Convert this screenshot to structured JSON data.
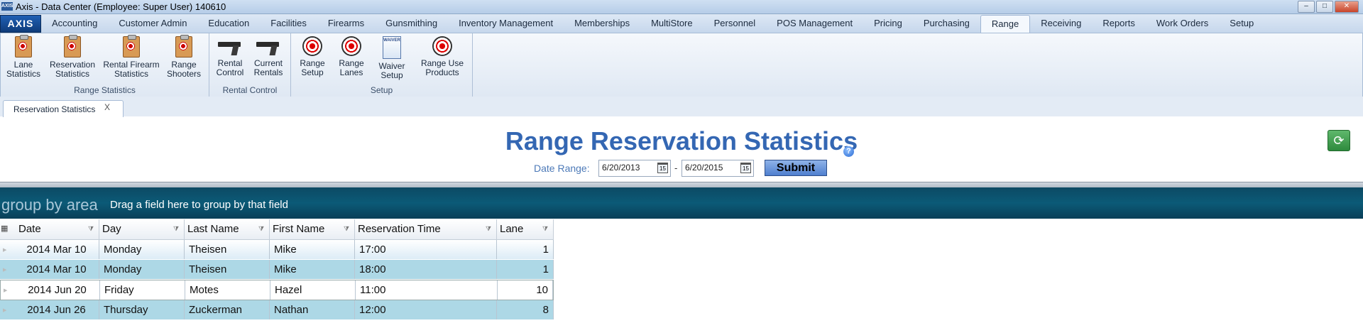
{
  "window": {
    "title": "Axis - Data Center  (Employee: Super User) 140610",
    "app_icon": "AXIS",
    "buttons": {
      "minimize": "–",
      "maximize": "□",
      "close": "✕"
    }
  },
  "menu": {
    "logo": "AXIS",
    "tabs": [
      "Accounting",
      "Customer Admin",
      "Education",
      "Facilities",
      "Firearms",
      "Gunsmithing",
      "Inventory Management",
      "Memberships",
      "MultiStore",
      "Personnel",
      "POS Management",
      "Pricing",
      "Purchasing",
      "Range",
      "Receiving",
      "Reports",
      "Work Orders",
      "Setup"
    ],
    "active_tab": "Range"
  },
  "ribbon": {
    "groups": [
      {
        "label": "Range Statistics",
        "buttons": [
          {
            "line1": "Lane",
            "line2": "Statistics",
            "icon": "clipboard-target-icon"
          },
          {
            "line1": "Reservation",
            "line2": "Statistics",
            "icon": "clipboard-target-icon"
          },
          {
            "line1": "Rental Firearm",
            "line2": "Statistics",
            "icon": "clipboard-gun-icon"
          },
          {
            "line1": "Range",
            "line2": "Shooters",
            "icon": "clipboard-shooter-icon"
          }
        ]
      },
      {
        "label": "Rental Control",
        "buttons": [
          {
            "line1": "Rental",
            "line2": "Control",
            "icon": "pistol-icon"
          },
          {
            "line1": "Current",
            "line2": "Rentals",
            "icon": "pistol-icon"
          }
        ]
      },
      {
        "label": "Setup",
        "buttons": [
          {
            "line1": "Range",
            "line2": "Setup",
            "icon": "target-icon"
          },
          {
            "line1": "Range",
            "line2": "Lanes",
            "icon": "target-icon"
          },
          {
            "line1": "Waiver",
            "line2": "Setup",
            "icon": "waiver-document-icon",
            "badge": "WAIVER"
          },
          {
            "line1": "Range Use",
            "line2": "Products",
            "icon": "target-icon"
          }
        ]
      }
    ]
  },
  "doc_tab": {
    "label": "Reservation Statistics",
    "close": "X"
  },
  "page": {
    "title": "Range Reservation Statistics",
    "help": "?",
    "refresh_icon": "refresh-icon",
    "date_range_label": "Date Range:",
    "start_date": "6/20/2013",
    "end_date": "6/20/2015",
    "date_separator": "-",
    "calendar_day": "15",
    "submit_label": "Submit"
  },
  "grid": {
    "group_title": "group by area",
    "group_hint": "Drag a field here to group by that field",
    "columns": [
      "Date",
      "Day",
      "Last Name",
      "First Name",
      "Reservation Time",
      "Lane"
    ],
    "rows": [
      [
        "2014 Mar 10",
        "Monday",
        "Theisen",
        "Mike",
        "17:00",
        "1"
      ],
      [
        "2014 Mar 10",
        "Monday",
        "Theisen",
        "Mike",
        "18:00",
        "1"
      ],
      [
        "2014 Jun 20",
        "Friday",
        "Motes",
        "Hazel",
        "11:00",
        "10"
      ],
      [
        "2014 Jun 26",
        "Thursday",
        "Zuckerman",
        "Nathan",
        "12:00",
        "8"
      ]
    ]
  },
  "colors": {
    "title_blue": "#3467b3",
    "row_alt": "#add8e6",
    "group_bar": "#0b5a77",
    "submit": "#4f7fcf"
  }
}
